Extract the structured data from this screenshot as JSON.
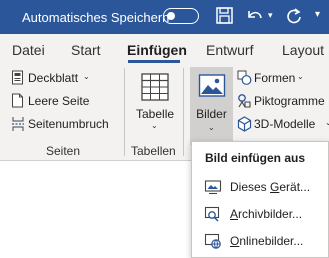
{
  "titlebar": {
    "autosave_label": "Automatisches Speichern",
    "autosave_state": "off"
  },
  "tabs": [
    {
      "label": "Datei"
    },
    {
      "label": "Start"
    },
    {
      "label": "Einfügen",
      "active": true
    },
    {
      "label": "Entwurf"
    },
    {
      "label": "Layout"
    }
  ],
  "ribbon": {
    "seiten": {
      "items": [
        {
          "label": "Deckblatt"
        },
        {
          "label": "Leere Seite"
        },
        {
          "label": "Seitenumbruch"
        }
      ],
      "group_label": "Seiten"
    },
    "tabellen": {
      "button_label": "Tabelle",
      "group_label": "Tabellen"
    },
    "illustrationen": {
      "bilder_label": "Bilder",
      "formen_label": "Formen",
      "piktogramme_label": "Piktogramme",
      "modelle_label": "3D-Modelle"
    }
  },
  "dropdown": {
    "title": "Bild einfügen aus",
    "items": [
      {
        "label": "Dieses Gerät...",
        "access_key": "G",
        "icon": "device-icon"
      },
      {
        "label": "Archivbilder...",
        "access_key": "A",
        "icon": "stock-images-icon"
      },
      {
        "label": "Onlinebilder...",
        "access_key": "O",
        "icon": "online-pictures-icon"
      }
    ]
  },
  "colors": {
    "titlebar": "#2b579a",
    "ribbon": "#f3f2f1",
    "selected_button": "#d2d0ce",
    "icon_blue": "#2b579a"
  }
}
